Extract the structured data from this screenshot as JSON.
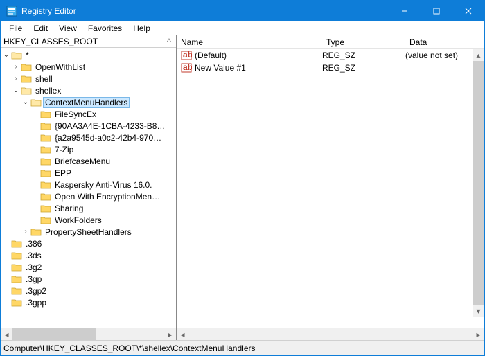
{
  "window": {
    "title": "Registry Editor"
  },
  "menu": [
    "File",
    "Edit",
    "View",
    "Favorites",
    "Help"
  ],
  "tree": {
    "header": "HKEY_CLASSES_ROOT",
    "items": [
      {
        "indent": 0,
        "exp": "v",
        "label": "*"
      },
      {
        "indent": 1,
        "exp": ">",
        "label": "OpenWithList"
      },
      {
        "indent": 1,
        "exp": ">",
        "label": "shell"
      },
      {
        "indent": 1,
        "exp": "v",
        "label": "shellex"
      },
      {
        "indent": 2,
        "exp": "v",
        "label": "ContextMenuHandlers",
        "selected": true
      },
      {
        "indent": 3,
        "exp": "",
        "label": " FileSyncEx"
      },
      {
        "indent": 3,
        "exp": "",
        "label": "{90AA3A4E-1CBA-4233-B8…"
      },
      {
        "indent": 3,
        "exp": "",
        "label": "{a2a9545d-a0c2-42b4-970…"
      },
      {
        "indent": 3,
        "exp": "",
        "label": "7-Zip"
      },
      {
        "indent": 3,
        "exp": "",
        "label": "BriefcaseMenu"
      },
      {
        "indent": 3,
        "exp": "",
        "label": "EPP"
      },
      {
        "indent": 3,
        "exp": "",
        "label": "Kaspersky Anti-Virus 16.0."
      },
      {
        "indent": 3,
        "exp": "",
        "label": "Open With EncryptionMen…"
      },
      {
        "indent": 3,
        "exp": "",
        "label": "Sharing"
      },
      {
        "indent": 3,
        "exp": "",
        "label": "WorkFolders"
      },
      {
        "indent": 2,
        "exp": ">",
        "label": "PropertySheetHandlers"
      },
      {
        "indent": 0,
        "exp": "",
        "label": ".386"
      },
      {
        "indent": 0,
        "exp": "",
        "label": ".3ds"
      },
      {
        "indent": 0,
        "exp": "",
        "label": ".3g2"
      },
      {
        "indent": 0,
        "exp": "",
        "label": ".3gp"
      },
      {
        "indent": 0,
        "exp": "",
        "label": ".3gp2"
      },
      {
        "indent": 0,
        "exp": "",
        "label": ".3gpp"
      }
    ]
  },
  "list": {
    "columns": {
      "name": "Name",
      "type": "Type",
      "data": "Data"
    },
    "rows": [
      {
        "name": "(Default)",
        "type": "REG_SZ",
        "data": "(value not set)"
      },
      {
        "name": "New Value #1",
        "type": "REG_SZ",
        "data": ""
      }
    ]
  },
  "statusbar": "Computer\\HKEY_CLASSES_ROOT\\*\\shellex\\ContextMenuHandlers"
}
